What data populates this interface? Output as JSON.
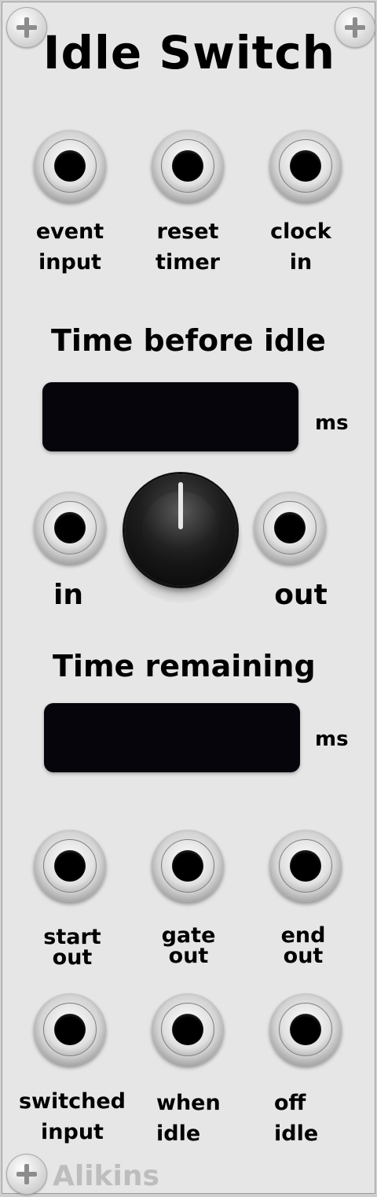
{
  "module": {
    "title": "Idle Switch",
    "brand": "Alikins"
  },
  "top_jacks": [
    {
      "line1": "event",
      "line2": "input"
    },
    {
      "line1": "reset",
      "line2": "timer"
    },
    {
      "line1": "clock",
      "line2": "in"
    }
  ],
  "time_before_idle": {
    "title": "Time before idle",
    "display_value": "",
    "unit": "ms",
    "in_label": "in",
    "out_label": "out"
  },
  "time_remaining": {
    "title": "Time remaining",
    "display_value": "",
    "unit": "ms"
  },
  "gate_outputs": [
    {
      "line1": "start",
      "line2": "out"
    },
    {
      "line1": "gate",
      "line2": "out"
    },
    {
      "line1": "end",
      "line2": "out"
    }
  ],
  "switched_outputs": [
    {
      "line1": "switched",
      "line2": "input"
    },
    {
      "line1": "when",
      "line2": "idle"
    },
    {
      "line1": "off",
      "line2": "idle"
    }
  ],
  "icons": {
    "screw": "screw-icon"
  }
}
